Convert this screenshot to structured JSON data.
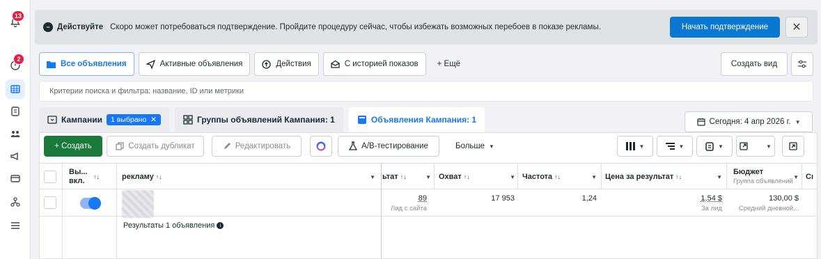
{
  "rail": {
    "notifications_badge": "13",
    "alerts_badge": "2",
    "icons": [
      "bell-icon",
      "alert-icon",
      "table-icon",
      "documents-icon",
      "audience-icon",
      "megaphone-icon",
      "billing-icon",
      "tree-icon",
      "menu-icon"
    ]
  },
  "banner": {
    "title": "Действуйте",
    "text": "Скоро может потребоваться подтверждение. Пройдите процедуру сейчас, чтобы избежать возможных перебоев в показе рекламы.",
    "button": "Начать подтверждение",
    "close": "✕"
  },
  "tabs": [
    {
      "label": "Все объявления",
      "icon": "folder-icon"
    },
    {
      "label": "Активные объявления",
      "icon": "send-icon"
    },
    {
      "label": "Действия",
      "icon": "action-icon"
    },
    {
      "label": "С историей показов",
      "icon": "history-icon"
    },
    {
      "label": "+ Ещё",
      "icon": ""
    }
  ],
  "view_button": "Создать вид",
  "search": {
    "placeholder": "Критерии поиска и фильтра: название, ID или метрики"
  },
  "level_tabs": {
    "campaigns": "Кампании",
    "selected": "1 выбрано",
    "adsets": "Группы объявлений Кампания: 1",
    "ads": "Объявления Кампания: 1"
  },
  "date": "Сегодня: 4 апр 2026 г.",
  "toolbar": {
    "create": "+ Создать",
    "duplicate": "Создать дубликат",
    "edit": "Редактировать",
    "ab": "A/B-тестирование",
    "more": "Больше"
  },
  "columns": {
    "toggle": "Вы... вкл.",
    "ad": "рекламу",
    "results": "ьтат",
    "reach": "Охват",
    "frequency": "Частота",
    "cpr": "Цена за результат",
    "budget": "Бюджет",
    "budget_sub": "Группа объявлений",
    "extra": "Сı"
  },
  "row": {
    "results": "89",
    "results_sub": "Лид с сайта",
    "reach": "17 953",
    "frequency": "1,24",
    "cpr": "1,54 $",
    "cpr_sub": "За лид",
    "budget": "130,00 $",
    "budget_sub": "Средний дневной..."
  },
  "summary": "Результаты 1 объявления",
  "colors": {
    "accent": "#1877f2",
    "create": "#1a7a3a",
    "banner_button": "#0a78d0",
    "badge": "#e41e3f"
  }
}
